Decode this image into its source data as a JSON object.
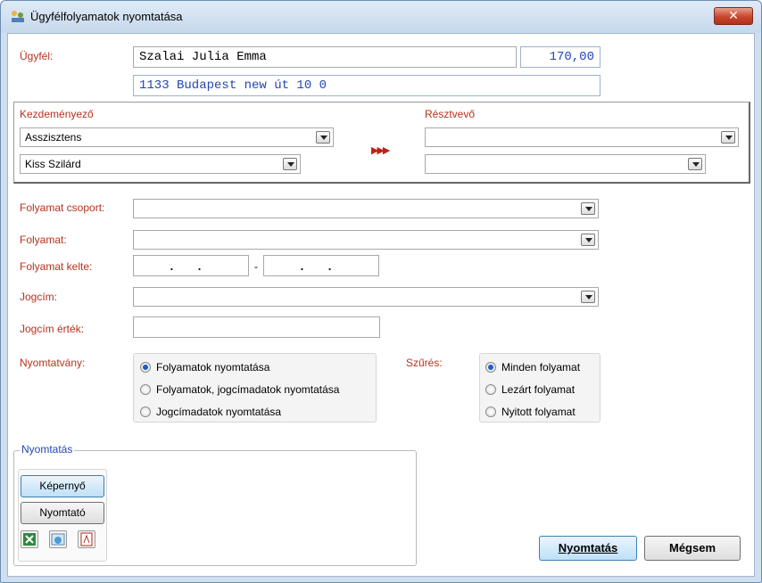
{
  "window": {
    "title": "Ügyfélfolyamatok nyomtatása",
    "close_label": "✕"
  },
  "client": {
    "label": "Ügyfél:",
    "name": "Szalai Julia Emma",
    "amount": "170,00",
    "address": "1133 Budapest new út 10 0"
  },
  "initiator": {
    "label": "Kezdeményező",
    "role": "Asszisztens",
    "person": "Kiss Szilárd"
  },
  "participant": {
    "label": "Résztvevő",
    "role": "",
    "person": ""
  },
  "arrows": "▶▶▶",
  "form": {
    "process_group_label": "Folyamat csoport:",
    "process_group_value": "",
    "process_label": "Folyamat:",
    "process_value": "",
    "date_label": "Folyamat kelte:",
    "date_from": ". .",
    "date_sep": "-",
    "date_to": ". .",
    "title_label": "Jogcím:",
    "title_value": "",
    "title_value_label": "Jogcím érték:",
    "title_value_value": ""
  },
  "print_type": {
    "label": "Nyomtatvány:",
    "options": [
      "Folyamatok nyomtatása",
      "Folyamatok, jogcímadatok nyomtatása",
      "Jogcímadatok nyomtatása"
    ],
    "selected": 0
  },
  "filter": {
    "label": "Szűrés:",
    "options": [
      "Minden folyamat",
      "Lezárt folyamat",
      "Nyitott folyamat"
    ],
    "selected": 0
  },
  "print_group": {
    "legend": "Nyomtatás",
    "screen_label": "Képernyő",
    "printer_label": "Nyomtató",
    "export_icons": [
      "excel-icon",
      "web-export-icon",
      "pdf-icon"
    ]
  },
  "buttons": {
    "print": "Nyomtatás",
    "cancel": "Mégsem"
  },
  "colors": {
    "label_red": "#b4321e",
    "label_blue": "#2346b5",
    "accent": "#3c7fb1"
  }
}
